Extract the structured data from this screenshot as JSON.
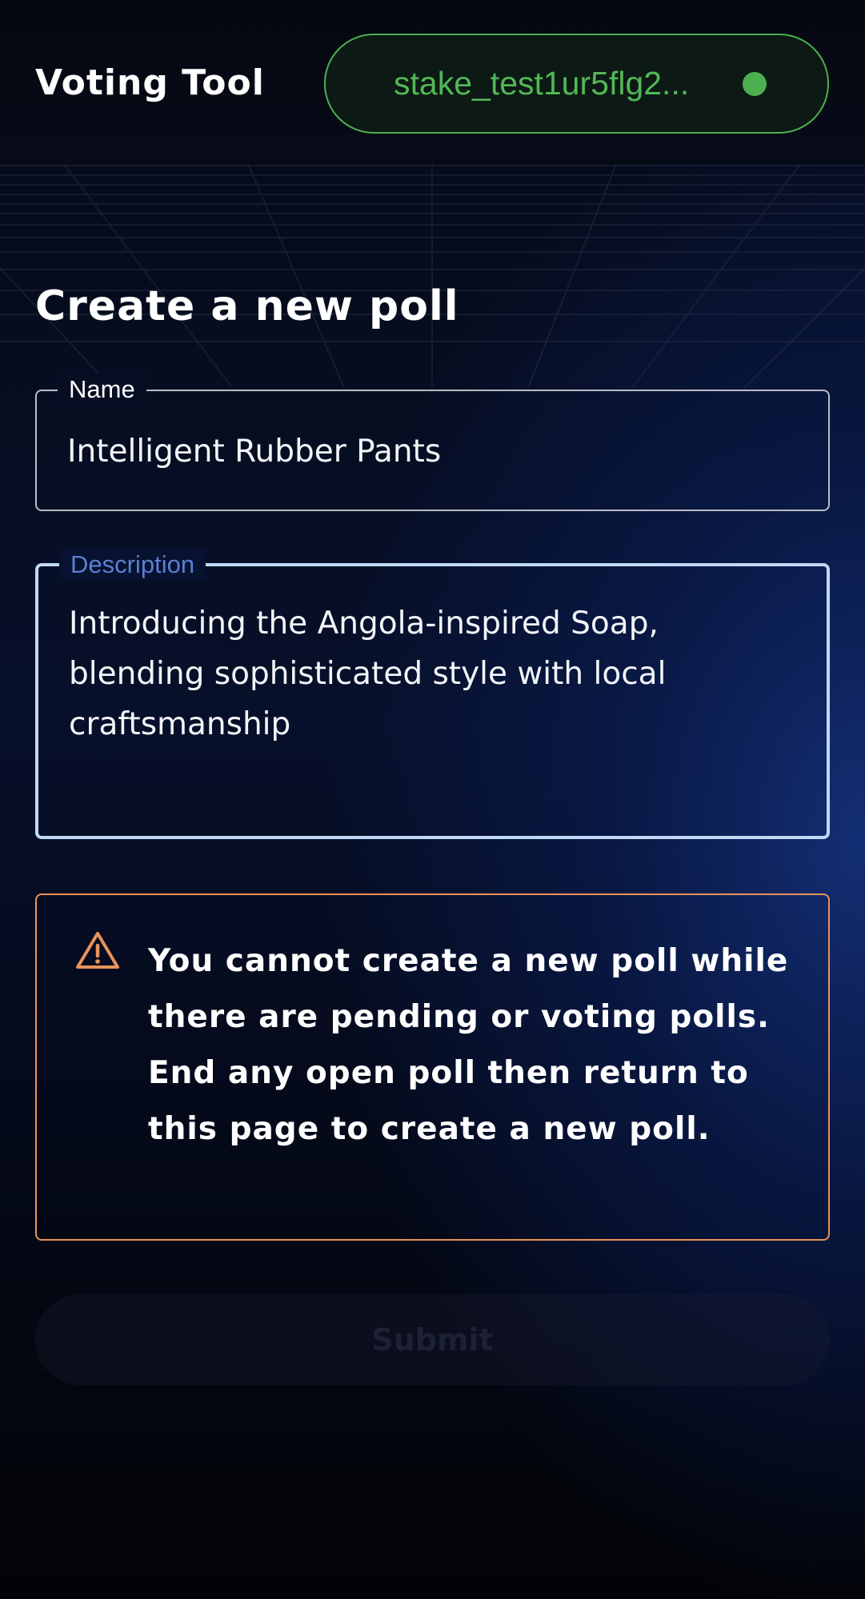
{
  "header": {
    "title": "Voting Tool",
    "wallet": {
      "address": "stake_test1ur5flg2...",
      "status_color": "#4caf50"
    }
  },
  "page": {
    "title": "Create a new poll"
  },
  "form": {
    "name": {
      "label": "Name",
      "value": "Intelligent Rubber Pants"
    },
    "description": {
      "label": "Description",
      "value": "Introducing the Angola-inspired Soap, blending sophisticated style with local craftsmanship"
    }
  },
  "alert": {
    "icon": "warning-icon",
    "color": "#e8935a",
    "message": "You cannot create a new poll while there are pending or voting polls. End any open poll then return to this page to create a new poll."
  },
  "actions": {
    "submit_label": "Submit",
    "submit_disabled": true
  }
}
